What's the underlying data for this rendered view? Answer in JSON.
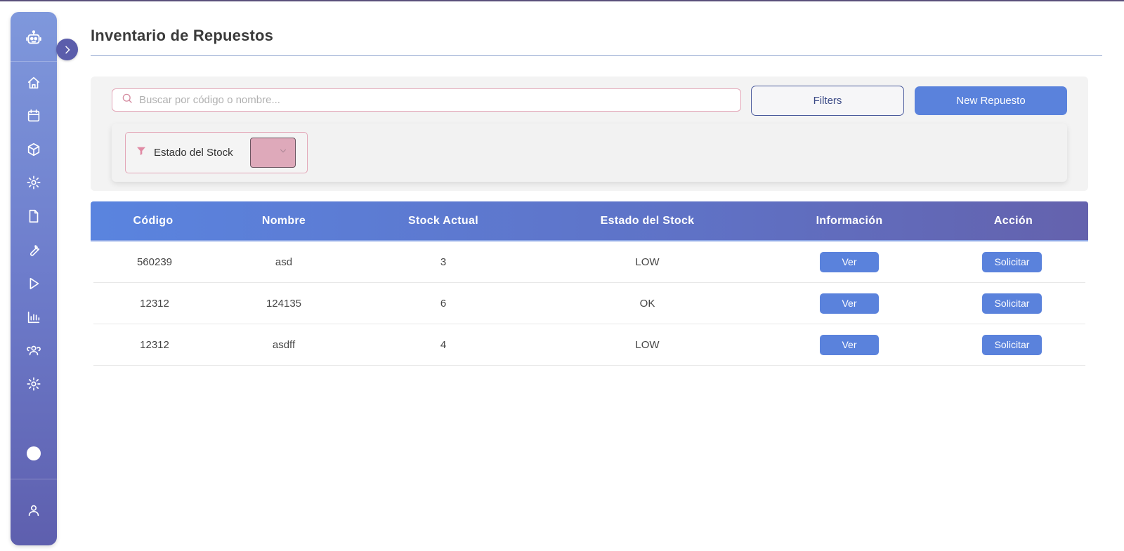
{
  "page": {
    "title": "Inventario de Repuestos"
  },
  "sidebar": {
    "logo_icon": "robot-icon",
    "toggle_icon": "chevron-right-icon",
    "items": [
      {
        "name": "home",
        "icon": "home-icon"
      },
      {
        "name": "calendar",
        "icon": "calendar-icon"
      },
      {
        "name": "inventory",
        "icon": "box-icon"
      },
      {
        "name": "maintenance",
        "icon": "gear-icon"
      },
      {
        "name": "documents",
        "icon": "file-icon"
      },
      {
        "name": "tools",
        "icon": "wrench-icon"
      },
      {
        "name": "play",
        "icon": "play-icon"
      },
      {
        "name": "reports",
        "icon": "bar-chart-icon"
      },
      {
        "name": "users",
        "icon": "users-icon"
      },
      {
        "name": "settings",
        "icon": "settings-icon"
      }
    ],
    "theme_icon": "theme-toggle-icon",
    "user_icon": "user-icon"
  },
  "toolbar": {
    "search_placeholder": "Buscar por código o nombre...",
    "search_value": "",
    "filters_label": "Filters",
    "new_label": "New Repuesto"
  },
  "filters": {
    "stock_state_label": "Estado del Stock",
    "stock_state_value": ""
  },
  "table": {
    "columns": [
      "Código",
      "Nombre",
      "Stock Actual",
      "Estado del Stock",
      "Información",
      "Acción"
    ],
    "rows": [
      {
        "codigo": "560239",
        "nombre": "asd",
        "stock": "3",
        "estado": "LOW",
        "ver": "Ver",
        "accion": "Solicitar"
      },
      {
        "codigo": "12312",
        "nombre": "124135",
        "stock": "6",
        "estado": "OK",
        "ver": "Ver",
        "accion": "Solicitar"
      },
      {
        "codigo": "12312",
        "nombre": "asdff",
        "stock": "4",
        "estado": "LOW",
        "ver": "Ver",
        "accion": "Solicitar"
      }
    ]
  },
  "colors": {
    "accent": "#5a82dc",
    "sidebar_top": "#7f98dc",
    "sidebar_bottom": "#5e5fae",
    "pink_border": "#e3a7b8"
  }
}
